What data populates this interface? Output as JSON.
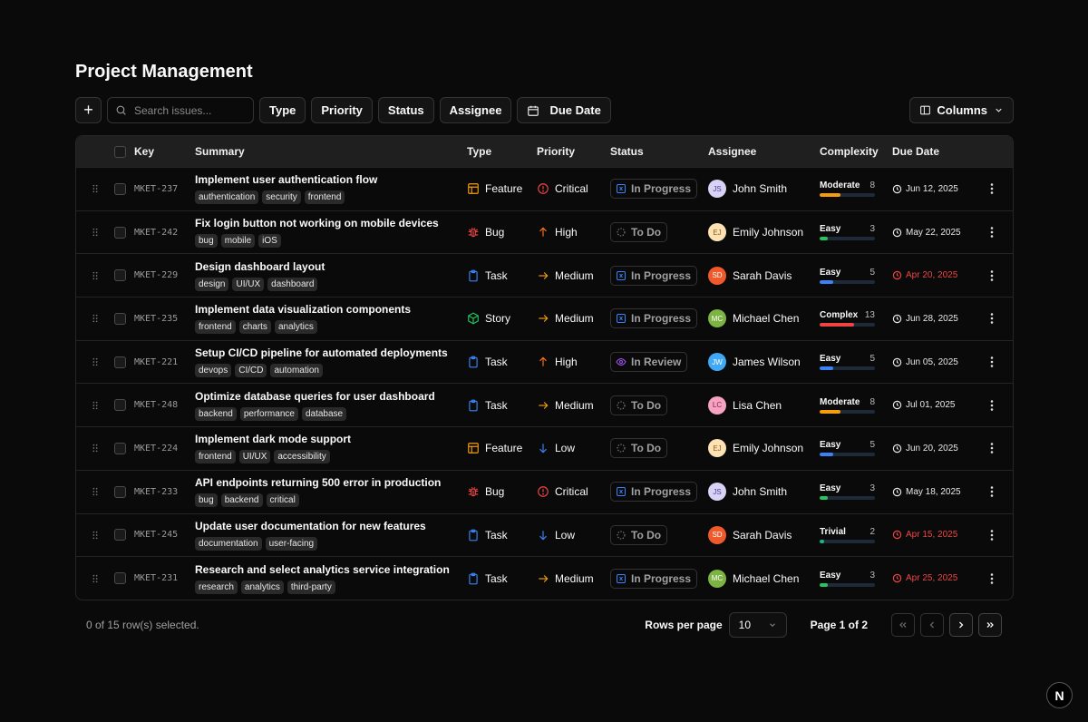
{
  "page": {
    "title": "Project Management"
  },
  "toolbar": {
    "add_label": "+",
    "search_placeholder": "Search issues...",
    "filters": [
      "Type",
      "Priority",
      "Status",
      "Assignee"
    ],
    "due_date_label": "Due Date",
    "columns_label": "Columns"
  },
  "table": {
    "headers": {
      "key": "Key",
      "summary": "Summary",
      "type": "Type",
      "priority": "Priority",
      "status": "Status",
      "assignee": "Assignee",
      "complexity": "Complexity",
      "due": "Due Date"
    },
    "rows": [
      {
        "key": "MKET-237",
        "summary": "Implement user authentication flow",
        "tags": [
          "authentication",
          "security",
          "frontend"
        ],
        "type": "Feature",
        "priority": "Critical",
        "status": "In Progress",
        "assignee": {
          "initials": "JS",
          "name": "John Smith"
        },
        "complexity": {
          "label": "Moderate",
          "points": 8,
          "level": 0.38
        },
        "due": {
          "date": "Jun 12, 2025",
          "overdue": false
        }
      },
      {
        "key": "MKET-242",
        "summary": "Fix login button not working on mobile devices",
        "tags": [
          "bug",
          "mobile",
          "iOS"
        ],
        "type": "Bug",
        "priority": "High",
        "status": "To Do",
        "assignee": {
          "initials": "EJ",
          "name": "Emily Johnson"
        },
        "complexity": {
          "label": "Easy",
          "points": 3,
          "level": 0.14
        },
        "due": {
          "date": "May 22, 2025",
          "overdue": false
        }
      },
      {
        "key": "MKET-229",
        "summary": "Design dashboard layout",
        "tags": [
          "design",
          "UI/UX",
          "dashboard"
        ],
        "type": "Task",
        "priority": "Medium",
        "status": "In Progress",
        "assignee": {
          "initials": "SD",
          "name": "Sarah Davis"
        },
        "complexity": {
          "label": "Easy",
          "points": 5,
          "level": 0.24
        },
        "due": {
          "date": "Apr 20, 2025",
          "overdue": true
        }
      },
      {
        "key": "MKET-235",
        "summary": "Implement data visualization components",
        "tags": [
          "frontend",
          "charts",
          "analytics"
        ],
        "type": "Story",
        "priority": "Medium",
        "status": "In Progress",
        "assignee": {
          "initials": "MC",
          "name": "Michael Chen"
        },
        "complexity": {
          "label": "Complex",
          "points": 13,
          "level": 0.62
        },
        "due": {
          "date": "Jun 28, 2025",
          "overdue": false
        }
      },
      {
        "key": "MKET-221",
        "summary": "Setup CI/CD pipeline for automated deployments",
        "tags": [
          "devops",
          "CI/CD",
          "automation"
        ],
        "type": "Task",
        "priority": "High",
        "status": "In Review",
        "assignee": {
          "initials": "JW",
          "name": "James Wilson"
        },
        "complexity": {
          "label": "Easy",
          "points": 5,
          "level": 0.24
        },
        "due": {
          "date": "Jun 05, 2025",
          "overdue": false
        }
      },
      {
        "key": "MKET-248",
        "summary": "Optimize database queries for user dashboard",
        "tags": [
          "backend",
          "performance",
          "database"
        ],
        "type": "Task",
        "priority": "Medium",
        "status": "To Do",
        "assignee": {
          "initials": "LC",
          "name": "Lisa Chen"
        },
        "complexity": {
          "label": "Moderate",
          "points": 8,
          "level": 0.38
        },
        "due": {
          "date": "Jul 01, 2025",
          "overdue": false
        }
      },
      {
        "key": "MKET-224",
        "summary": "Implement dark mode support",
        "tags": [
          "frontend",
          "UI/UX",
          "accessibility"
        ],
        "type": "Feature",
        "priority": "Low",
        "status": "To Do",
        "assignee": {
          "initials": "EJ",
          "name": "Emily Johnson"
        },
        "complexity": {
          "label": "Easy",
          "points": 5,
          "level": 0.24
        },
        "due": {
          "date": "Jun 20, 2025",
          "overdue": false
        }
      },
      {
        "key": "MKET-233",
        "summary": "API endpoints returning 500 error in production",
        "tags": [
          "bug",
          "backend",
          "critical"
        ],
        "type": "Bug",
        "priority": "Critical",
        "status": "In Progress",
        "assignee": {
          "initials": "JS",
          "name": "John Smith"
        },
        "complexity": {
          "label": "Easy",
          "points": 3,
          "level": 0.14
        },
        "due": {
          "date": "May 18, 2025",
          "overdue": false
        }
      },
      {
        "key": "MKET-245",
        "summary": "Update user documentation for new features",
        "tags": [
          "documentation",
          "user-facing"
        ],
        "type": "Task",
        "priority": "Low",
        "status": "To Do",
        "assignee": {
          "initials": "SD",
          "name": "Sarah Davis"
        },
        "complexity": {
          "label": "Trivial",
          "points": 2,
          "level": 0.09
        },
        "due": {
          "date": "Apr 15, 2025",
          "overdue": true
        }
      },
      {
        "key": "MKET-231",
        "summary": "Research and select analytics service integration",
        "tags": [
          "research",
          "analytics",
          "third-party"
        ],
        "type": "Task",
        "priority": "Medium",
        "status": "In Progress",
        "assignee": {
          "initials": "MC",
          "name": "Michael Chen"
        },
        "complexity": {
          "label": "Easy",
          "points": 3,
          "level": 0.14
        },
        "due": {
          "date": "Apr 25, 2025",
          "overdue": true
        }
      }
    ]
  },
  "footer": {
    "selection": "0 of 15 row(s) selected.",
    "rows_per_page_label": "Rows per page",
    "rows_per_page_value": "10",
    "page_info": "Page 1 of 2"
  },
  "corner_logo": "N",
  "colors": {
    "type": {
      "Feature": "#f59e0b",
      "Bug": "#ef4444",
      "Task": "#3b82f6",
      "Story": "#22c55e"
    },
    "priority": {
      "Critical": "#ef4444",
      "High": "#f97316",
      "Medium": "#f59e0b",
      "Low": "#3b82f6"
    },
    "complexity": {
      "Trivial": "#10b981",
      "Easy": "#3b82f6",
      "Moderate": "#f59e0b",
      "Complex": "#ef4444"
    },
    "avatar": {
      "JS": [
        "#d8d2f5",
        "#4c3d99"
      ],
      "EJ": [
        "#fde2b5",
        "#9a5b0c"
      ],
      "SD": [
        "#f05a2a",
        "#ffffff"
      ],
      "MC": [
        "#7cb342",
        "#ffffff"
      ],
      "JW": [
        "#3fa9f5",
        "#ffffff"
      ],
      "LC": [
        "#f5a3c0",
        "#8a1f45"
      ]
    },
    "easy_bar_first_rows": "#22c55e"
  },
  "icons": {
    "Feature": "layout-icon",
    "Bug": "bug-icon",
    "Task": "clipboard-icon",
    "Story": "box-icon",
    "Critical": "alert-circle-icon",
    "High": "arrow-up-icon",
    "Medium": "arrow-right-icon",
    "Low": "arrow-down-icon",
    "In Progress": "timer-icon",
    "To Do": "circle-dashed-icon",
    "In Review": "eye-icon"
  }
}
